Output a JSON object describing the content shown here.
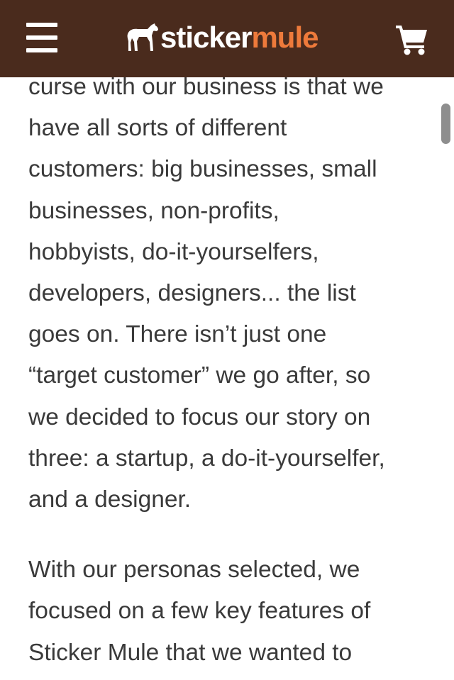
{
  "header": {
    "background_color": "#4a2b1d",
    "menu_icon": "hamburger-menu-icon",
    "cart_icon": "shopping-cart-icon",
    "logo": {
      "part1": "sticker",
      "part2": "mule",
      "part1_color": "#ffffff",
      "part2_color": "#ee7a3b",
      "icon": "horse-icon"
    }
  },
  "article": {
    "paragraph1_lines": [
      "curse with our business is that we",
      "have all sorts of different",
      "customers: big businesses, small",
      "businesses, non-profits,",
      "hobbyists, do-it-yourselfers,",
      "developers, designers... the list",
      "goes on. There isn’t just one",
      "“target customer” we go after, so",
      "we decided to focus our story on",
      "three: a startup, a do-it-yourselfer,",
      "and a designer."
    ],
    "paragraph2_lines": [
      "With our personas selected, we",
      "focused on a few key features of",
      "Sticker Mule that we wanted to"
    ]
  }
}
